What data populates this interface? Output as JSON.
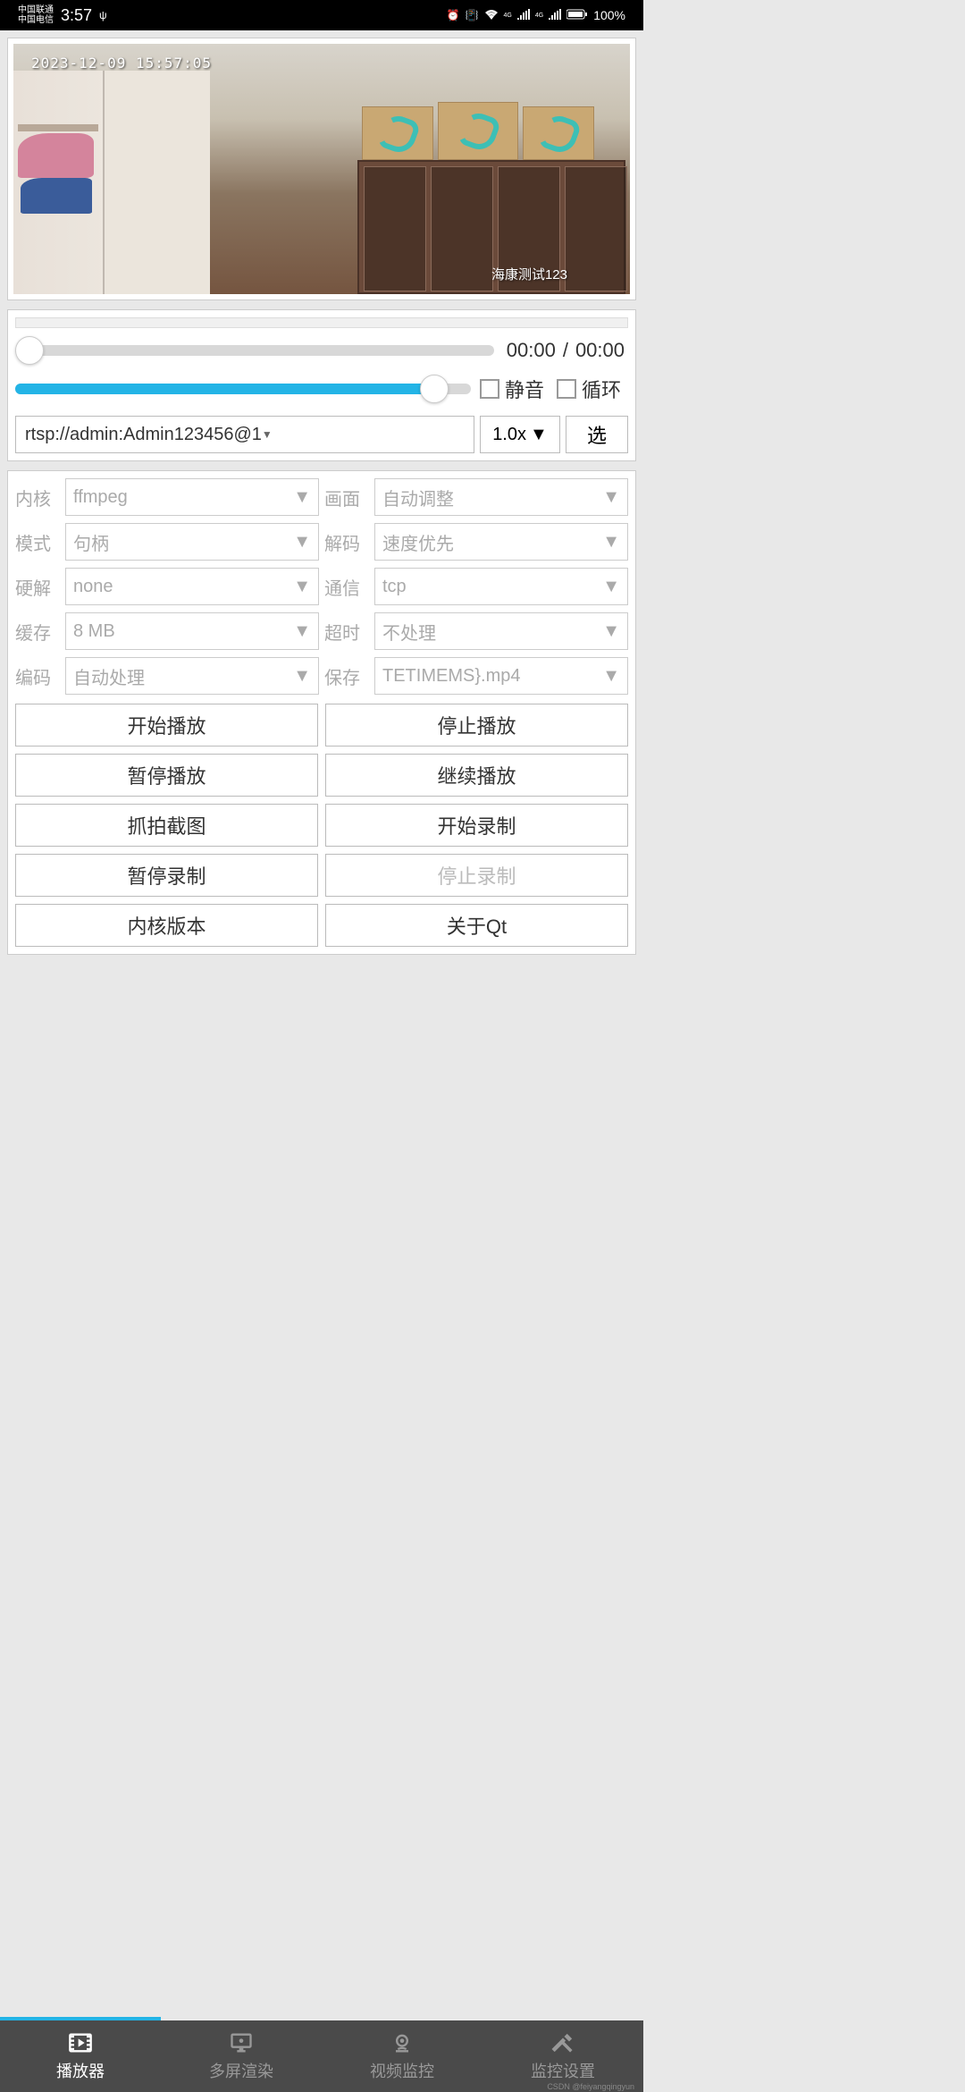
{
  "status": {
    "carrier1": "中国联通",
    "carrier2": "中国电信",
    "time": "3:57",
    "battery": "100%",
    "sig1": "4G",
    "sig2": "4G"
  },
  "video": {
    "timestamp": "2023-12-09 15:57:05",
    "overlay_text": "海康测试123"
  },
  "playback": {
    "time_current": "00:00",
    "time_separator": "/",
    "time_total": "00:00",
    "mute_label": "静音",
    "loop_label": "循环",
    "url": "rtsp://admin:Admin123456@1",
    "speed": "1.0x",
    "select_btn": "选"
  },
  "settings": {
    "labels": {
      "kernel": "内核",
      "screen": "画面",
      "mode": "模式",
      "decode": "解码",
      "hwdecode": "硬解",
      "comm": "通信",
      "cache": "缓存",
      "timeout": "超时",
      "encode": "编码",
      "save": "保存"
    },
    "values": {
      "kernel": "ffmpeg",
      "screen": "自动调整",
      "mode": "句柄",
      "decode": "速度优先",
      "hwdecode": "none",
      "comm": "tcp",
      "cache": "8 MB",
      "timeout": "不处理",
      "encode": "自动处理",
      "save": "TETIMEMS}.mp4"
    }
  },
  "buttons": {
    "play_start": "开始播放",
    "play_stop": "停止播放",
    "play_pause": "暂停播放",
    "play_resume": "继续播放",
    "screenshot": "抓拍截图",
    "record_start": "开始录制",
    "record_pause": "暂停录制",
    "record_stop": "停止录制",
    "kernel_version": "内核版本",
    "about_qt": "关于Qt"
  },
  "nav": {
    "player": "播放器",
    "multiscreen": "多屏渲染",
    "monitor": "视频监控",
    "settings": "监控设置"
  },
  "watermark": "CSDN @feiyangqingyun"
}
